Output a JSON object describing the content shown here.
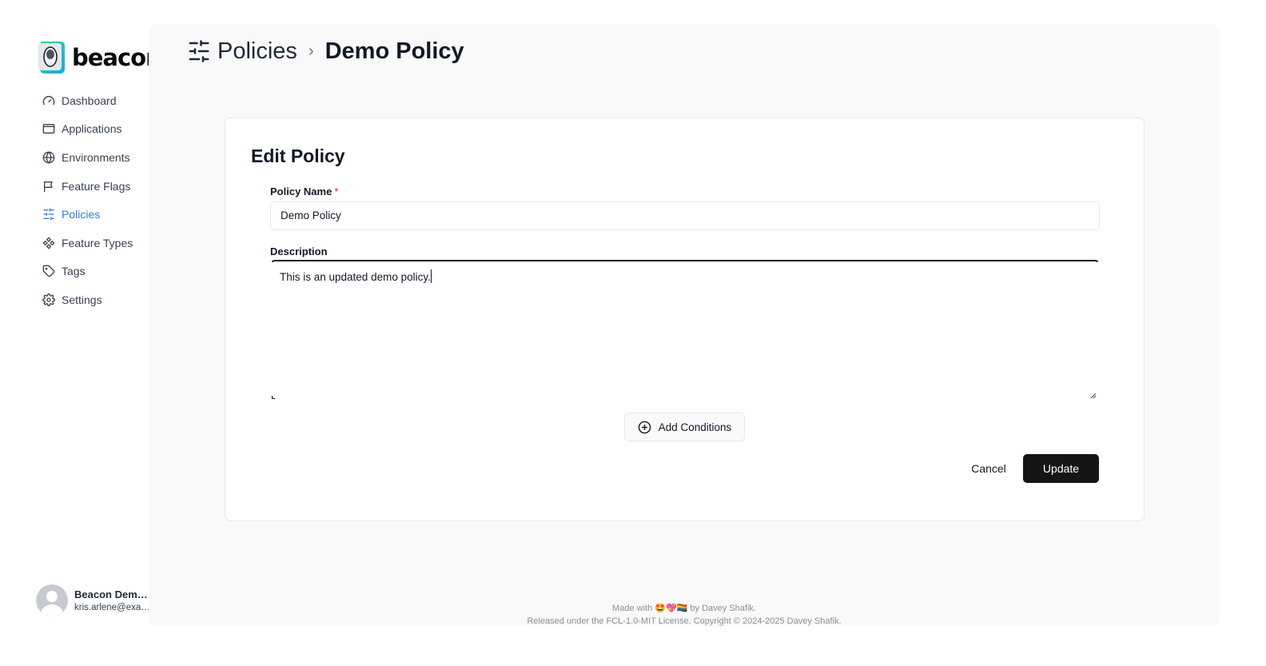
{
  "brand": {
    "name": "beacon"
  },
  "sidebar": {
    "items": [
      {
        "label": "Dashboard",
        "icon": "gauge-icon",
        "active": false
      },
      {
        "label": "Applications",
        "icon": "app-window-icon",
        "active": false
      },
      {
        "label": "Environments",
        "icon": "globe-icon",
        "active": false
      },
      {
        "label": "Feature Flags",
        "icon": "flag-icon",
        "active": false
      },
      {
        "label": "Policies",
        "icon": "sliders-icon",
        "active": true
      },
      {
        "label": "Feature Types",
        "icon": "component-icon",
        "active": false
      },
      {
        "label": "Tags",
        "icon": "tag-icon",
        "active": false
      },
      {
        "label": "Settings",
        "icon": "gear-icon",
        "active": false
      }
    ],
    "user": {
      "name": "Beacon Demo…",
      "email": "kris.arlene@exa…"
    }
  },
  "header": {
    "breadcrumb_parent": "Policies",
    "breadcrumb_separator": "›",
    "breadcrumb_current": "Demo Policy"
  },
  "form": {
    "title": "Edit Policy",
    "name_label": "Policy Name",
    "required_mark": "*",
    "name_value": "Demo Policy",
    "description_label": "Description",
    "description_value": "This is an updated demo policy.",
    "add_conditions_label": "Add Conditions",
    "cancel_label": "Cancel",
    "update_label": "Update"
  },
  "footer": {
    "made_with_prefix": "Made with",
    "emoji": "🤩💖🏳️‍🌈",
    "made_with_suffix": "by Davey Shafik.",
    "license": "Released under the FCL-1.0-MIT License. Copyright © 2024-2025 Davey Shafik."
  },
  "colors": {
    "accent": "#2f7fd4",
    "primary_button": "#151515",
    "required": "#dc2626",
    "main_background": "#f9f9f9"
  }
}
